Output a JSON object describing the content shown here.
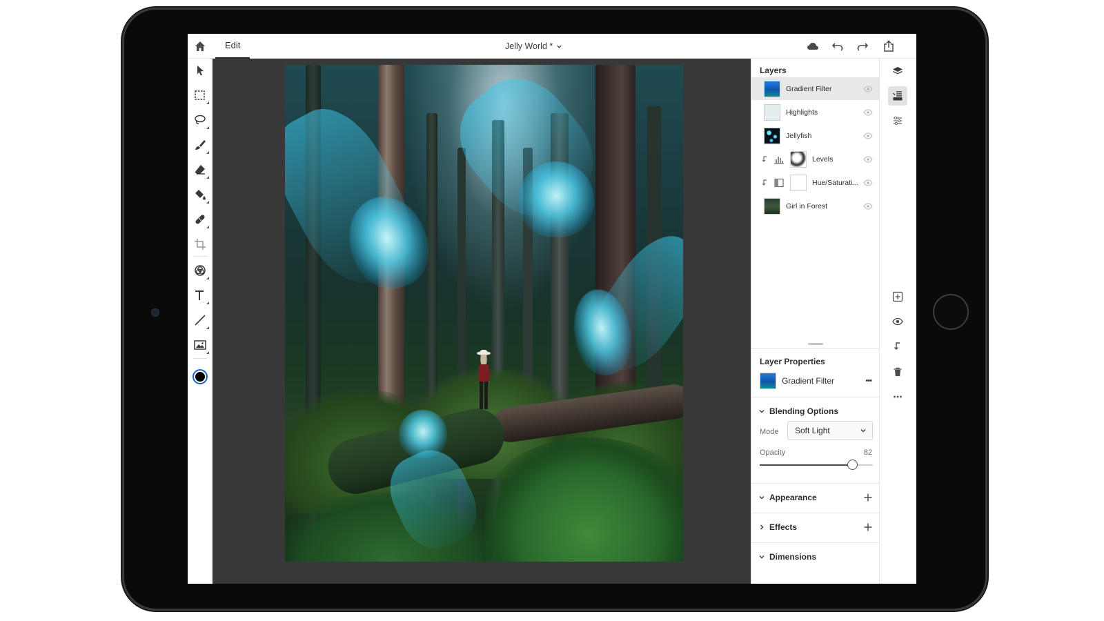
{
  "app": {
    "tab_edit": "Edit",
    "document_title": "Jelly World *"
  },
  "topbar": {
    "icons": [
      "home-icon",
      "cloud-icon",
      "undo-icon",
      "redo-icon",
      "share-icon"
    ]
  },
  "toolbar": {
    "tools": [
      "select-icon",
      "marquee-icon",
      "lasso-icon",
      "brush-icon",
      "eraser-icon",
      "fill-icon",
      "heal-icon",
      "crop-icon",
      "blend-icon",
      "type-icon",
      "line-icon",
      "image-icon"
    ],
    "foreground_color": "#000000",
    "background_color": "#ffffff"
  },
  "layers": {
    "title": "Layers",
    "items": [
      {
        "name": "Gradient Filter",
        "selected": true,
        "visible": true,
        "thumb": "gradient"
      },
      {
        "name": "Highlights",
        "selected": false,
        "visible": true,
        "thumb": "pale"
      },
      {
        "name": "Jellyfish",
        "selected": false,
        "visible": true,
        "thumb": "jelly"
      },
      {
        "name": "Levels",
        "selected": false,
        "visible": true,
        "thumb": "levels",
        "clipped": true,
        "adjustment": "levels-icon"
      },
      {
        "name": "Hue/Saturati...",
        "selected": false,
        "visible": true,
        "thumb": "white",
        "clipped": true,
        "adjustment": "hue-saturation-icon"
      },
      {
        "name": "Girl in Forest",
        "selected": false,
        "visible": true,
        "thumb": "forest"
      }
    ]
  },
  "properties": {
    "title": "Layer Properties",
    "layer_name": "Gradient Filter",
    "more_label": "•••",
    "blending": {
      "header": "Blending Options",
      "mode_label": "Mode",
      "mode_value": "Soft Light",
      "opacity_label": "Opacity",
      "opacity_value": "82",
      "opacity_fraction": 0.82
    },
    "sections": [
      "Appearance",
      "Effects",
      "Dimensions"
    ]
  },
  "rail": {
    "icons": [
      "layers-icon",
      "layer-stack-icon",
      "adjustments-icon",
      "add-layer-icon",
      "visibility-icon",
      "clip-icon",
      "delete-icon",
      "more-icon"
    ]
  },
  "colors": {
    "accent_selected": "#e8e8e8",
    "canvas_bg": "#383838",
    "gradient_thumb": "#1560b8"
  }
}
